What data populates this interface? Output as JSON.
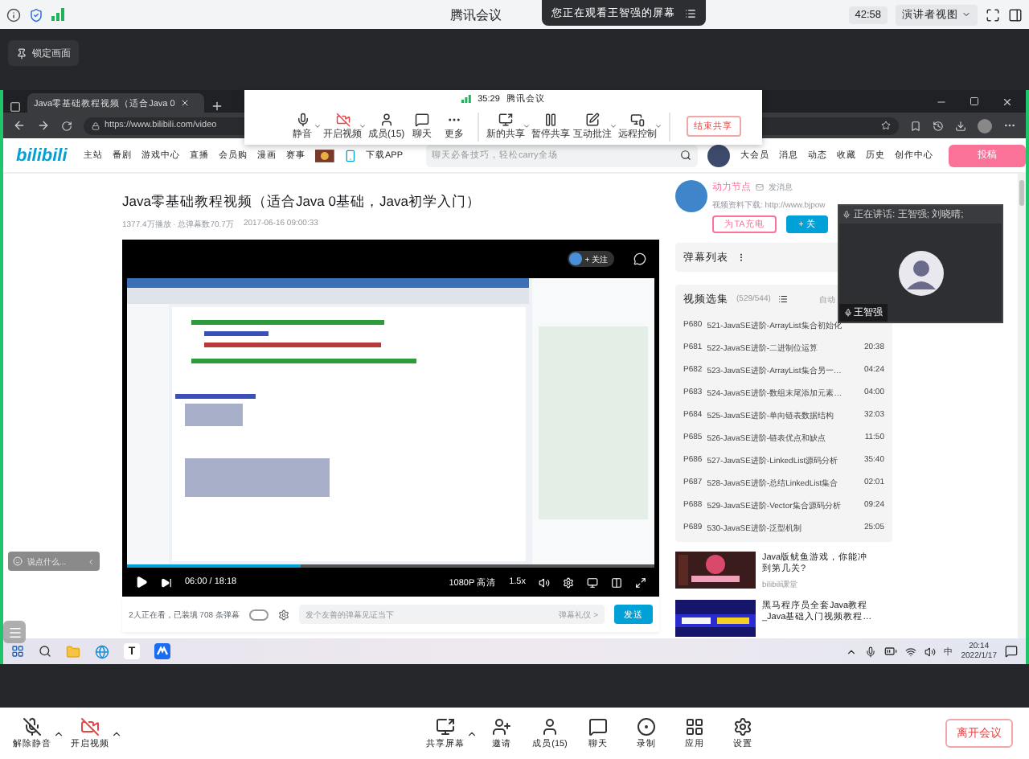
{
  "top_bar": {
    "title": "腾讯会议",
    "viewing_notice": "您正在观看王智强的屏幕",
    "timer": "42:58",
    "view_mode": "演讲者视图"
  },
  "lock_button": "锁定画面",
  "browser": {
    "tab_title": "Java零基础教程视频（适合Java 0",
    "url": "https://www.bilibili.com/video"
  },
  "share_toolbar": {
    "timer": "35:29",
    "title": "腾讯会议",
    "button_groups": [
      [
        {
          "label": "静音",
          "kind": "mic",
          "caret": true
        },
        {
          "label": "开启视频",
          "kind": "camera_off",
          "caret": true
        },
        {
          "label": "成员(15)",
          "kind": "members",
          "caret": false
        },
        {
          "label": "聊天",
          "kind": "chat",
          "caret": false
        },
        {
          "label": "更多",
          "kind": "more",
          "caret": false
        }
      ],
      [
        {
          "label": "新的共享",
          "kind": "share",
          "caret": true
        },
        {
          "label": "暂停共享",
          "kind": "pause",
          "caret": false
        },
        {
          "label": "互动批注",
          "kind": "annotate",
          "caret": true
        },
        {
          "label": "远程控制",
          "kind": "remote",
          "caret": true
        }
      ]
    ],
    "end_button": "结束共享"
  },
  "site": {
    "logo": "bilibili",
    "nav": [
      "主站",
      "番剧",
      "游戏中心",
      "直播",
      "会员购",
      "漫画",
      "赛事"
    ],
    "download_app": "下载APP",
    "search_placeholder": "聊天必备技巧，轻松carry全场",
    "user_nav": [
      "大会员",
      "消息",
      "动态",
      "收藏",
      "历史",
      "创作中心"
    ],
    "upload_button": "投稿"
  },
  "video": {
    "title": "Java零基础教程视频（适合Java 0基础，Java初学入门）",
    "meta": "1377.4万播放 · 总弹幕数70.7万",
    "date": "2017-06-16 09:00:33",
    "follow": "+ 关注",
    "time": "06:00 / 18:18",
    "quality": "1080P 高清",
    "speed": "1.5x",
    "level": 0.33,
    "viewers": "2人正在看，已装填 708 条弹幕",
    "danmaku_on": false,
    "danmaku_placeholder": "发个友善的弹幕见证当下",
    "etiquette": "弹幕礼仪 >",
    "send": "发送"
  },
  "uploader": {
    "name": "动力节点",
    "message": "发消息",
    "description": "视频资料下载: http://www.bjpow",
    "charge": "为TA充电",
    "follow": "+ 关"
  },
  "danmaku_list": "弹幕列表",
  "episodes": {
    "title": "视频选集",
    "count": "(529/544)",
    "autoplay": "自动",
    "items": [
      {
        "part": "P680",
        "title": "521-JavaSE进阶-ArrayList集合初始化"
      },
      {
        "part": "P681",
        "title": "522-JavaSE进阶-二进制位运算",
        "duration": "20:38"
      },
      {
        "part": "P682",
        "title": "523-JavaSE进阶-ArrayList集合另一…",
        "duration": "04:24"
      },
      {
        "part": "P683",
        "title": "524-JavaSE进阶-数组末尾添加元素…",
        "duration": "04:00"
      },
      {
        "part": "P684",
        "title": "525-JavaSE进阶-单向链表数据结构",
        "duration": "32:03"
      },
      {
        "part": "P685",
        "title": "526-JavaSE进阶-链表优点和缺点",
        "duration": "11:50"
      },
      {
        "part": "P686",
        "title": "527-JavaSE进阶-LinkedList源码分析",
        "duration": "35:40"
      },
      {
        "part": "P687",
        "title": "528-JavaSE进阶-总结LinkedList集合",
        "duration": "02:01"
      },
      {
        "part": "P688",
        "title": "529-JavaSE进阶-Vector集合源码分析",
        "duration": "09:24"
      },
      {
        "part": "P689",
        "title": "530-JavaSE进阶-泛型机制",
        "duration": "25:05"
      }
    ]
  },
  "recommendations": [
    {
      "title": "Java版鱿鱼游戏，你能冲到第几关?",
      "author": "bilibili课堂",
      "kind": "game"
    },
    {
      "title": "黑马程序员全套Java教程_Java基础入门视频教程…",
      "kind": "course"
    }
  ],
  "speaker": {
    "notice": "正在讲话: 王智强; 刘晓晴;",
    "name": "王智强"
  },
  "chat_pill": "说点什么...",
  "taskbar": {
    "app_letter": "T",
    "ime": "中",
    "time": "20:14",
    "date": "2022/1/17"
  },
  "meeting_bar": {
    "left": [
      {
        "label": "解除静音",
        "kind": "mic_off",
        "caret": true
      },
      {
        "label": "开启视频",
        "kind": "camera_off",
        "caret": true
      }
    ],
    "center": [
      {
        "label": "共享屏幕",
        "kind": "share",
        "caret": true
      },
      {
        "label": "邀请",
        "kind": "invite",
        "caret": false
      },
      {
        "label": "成员(15)",
        "kind": "members",
        "caret": false
      },
      {
        "label": "聊天",
        "kind": "chat",
        "caret": false
      },
      {
        "label": "录制",
        "kind": "record",
        "caret": false
      },
      {
        "label": "应用",
        "kind": "apps",
        "caret": false
      },
      {
        "label": "设置",
        "kind": "settings",
        "caret": false
      }
    ],
    "leave": "离开会议"
  }
}
